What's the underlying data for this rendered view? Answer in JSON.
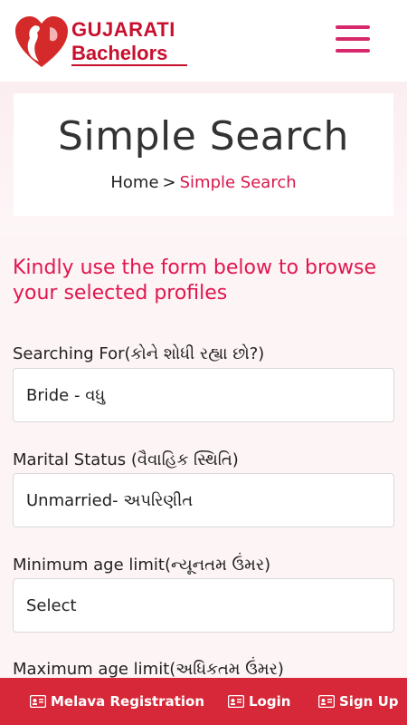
{
  "header": {
    "logo_line1": "GUJARATI",
    "logo_line2": "Bachelors",
    "menu_icon": "hamburger-menu-icon"
  },
  "title_card": {
    "title": "Simple Search",
    "breadcrumb": {
      "home": "Home",
      "separator": ">",
      "current": "Simple Search"
    }
  },
  "intro": "Kindly use the form below to browse your selected profiles",
  "form": {
    "searching_for": {
      "label": "Searching For(કોને શોધી રહ્યા છો?)",
      "value": "Bride - વધુ"
    },
    "marital_status": {
      "label": "Marital Status (વૈવાહિક સ્થિતિ)",
      "value": "Unmarried- અપરિણીત"
    },
    "min_age": {
      "label": "Minimum age limit(ન્યૂનતમ ઉંમર)",
      "value": "Select"
    },
    "max_age": {
      "label": "Maximum age limit(અધિકતમ ઉંમર)"
    }
  },
  "bottom_nav": {
    "melava": "Melava Registration",
    "login": "Login",
    "signup": "Sign Up",
    "icon": "id-card-icon"
  },
  "colors": {
    "brand_red": "#c8102e",
    "accent_pink": "#e0174f",
    "menu_pink": "#d6286b",
    "bottom_bar": "#d62839"
  }
}
